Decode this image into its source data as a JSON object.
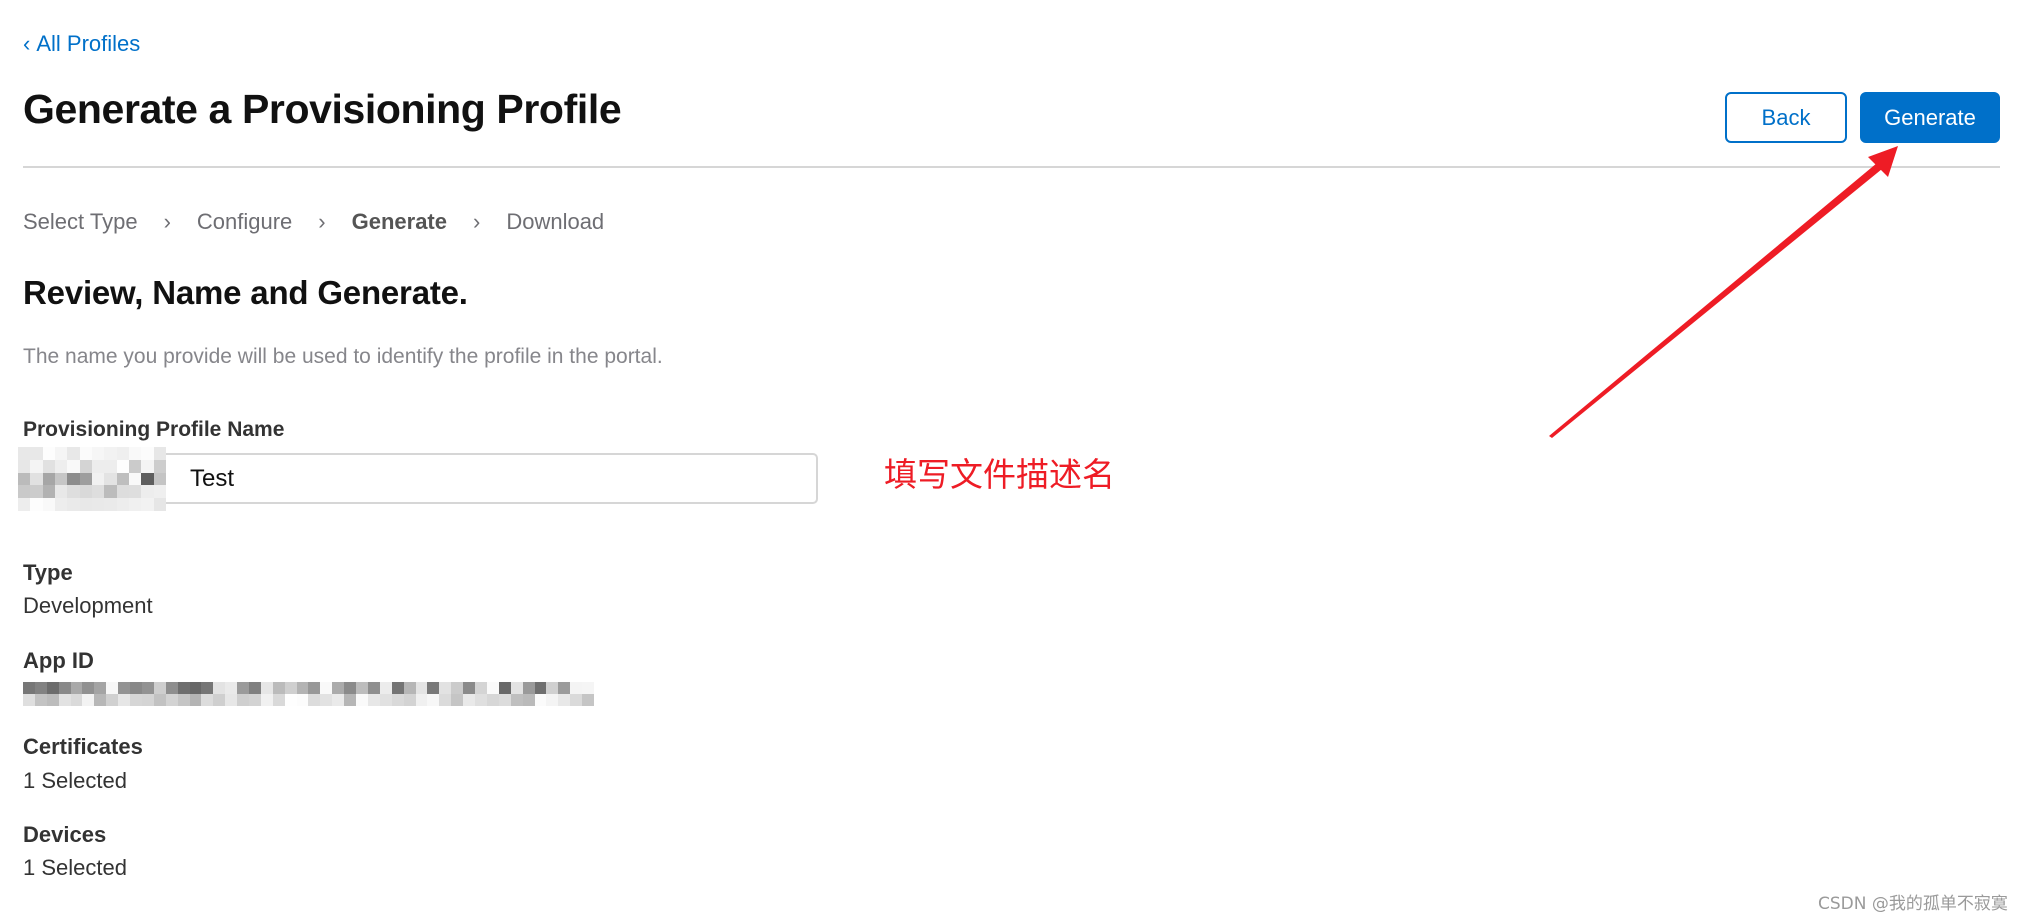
{
  "nav": {
    "back_link_icon": "chevron-left-icon",
    "back_link_chevron": "‹",
    "back_link_label": "All Profiles"
  },
  "header": {
    "title": "Generate a Provisioning Profile",
    "back_button": "Back",
    "generate_button": "Generate"
  },
  "steps": {
    "separator": "›",
    "items": [
      {
        "label": "Select Type",
        "current": false
      },
      {
        "label": "Configure",
        "current": false
      },
      {
        "label": "Generate",
        "current": true
      },
      {
        "label": "Download",
        "current": false
      }
    ]
  },
  "section": {
    "title": "Review, Name and Generate.",
    "description": "The name you provide will be used to identify the profile in the portal."
  },
  "form": {
    "name_label": "Provisioning Profile Name",
    "name_value_visible": "Test",
    "name_value_redacted": true
  },
  "details": {
    "type_label": "Type",
    "type_value": "Development",
    "app_id_label": "App ID",
    "app_id_redacted": true,
    "certificates_label": "Certificates",
    "certificates_value": "1 Selected",
    "devices_label": "Devices",
    "devices_value": "1 Selected"
  },
  "annotation": {
    "text": "填写文件描述名",
    "color": "#ee1c25",
    "arrow_target": "generate-button"
  },
  "watermark": "CSDN @我的孤单不寂寞",
  "colors": {
    "accent": "#0070c9",
    "annotation": "#ee1c25"
  }
}
